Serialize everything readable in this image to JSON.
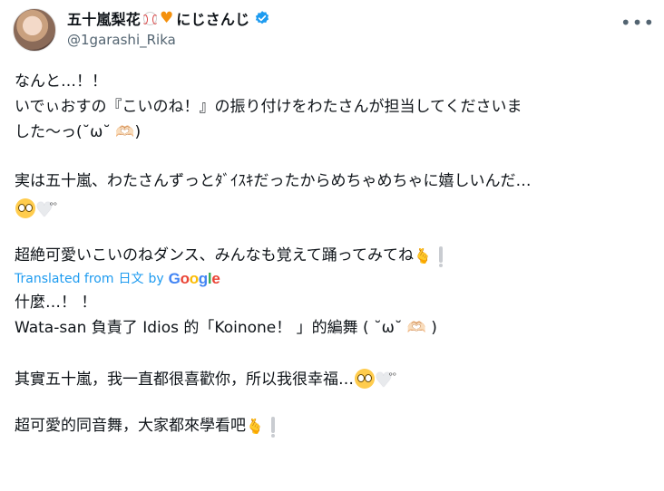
{
  "tweet": {
    "display_name": "五十嵐梨花",
    "display_suffix": "にじさんじ",
    "handle": "@1garashi_Rika",
    "original_lines": [
      "なんと…！！",
      "いでぃおすの『こいのね！』の振り付けをわたさんが担当してくださいま",
      "した〜っ(˘ω˘ 🫶🏻)"
    ],
    "original_line4": "実は五十嵐、わたさんずっとﾀﾞｲｽｷだったからめちゃめちゃに嬉しいんだ…",
    "original_line5": "超絶可愛いこいのねダンス、みんなも覚えて踊ってみてね",
    "translated_prefix": "Translated from",
    "translated_lang": "日文",
    "translated_by": "by",
    "google_letters": [
      "G",
      "o",
      "o",
      "g",
      "l",
      "e"
    ],
    "translation_lines": [
      "什麼…！ ！",
      "Wata-san 負責了 Idios 的「Koinone！ 」的編舞 ( ˘ω˘ 🫶🏻 )"
    ],
    "translation_line3": "其實五十嵐，我一直都很喜歡你，所以我很幸福…",
    "translation_line4": "超可愛的同音舞，大家都來學看吧",
    "icons": {
      "baseball": "baseball-icon",
      "heart": "orange-heart-icon",
      "verified": "verified-badge-icon",
      "more": "more-options-icon"
    },
    "colors": {
      "link_blue": "#1d9bf0",
      "secondary_text": "#536471",
      "verified_blue": "#1d9bf0"
    }
  }
}
